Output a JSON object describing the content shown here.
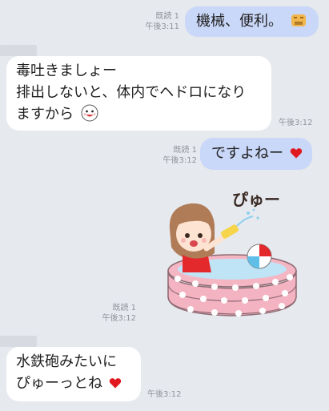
{
  "messages": [
    {
      "direction": "out",
      "text": "機械、便利。",
      "emoji": "face-with-lines-emoji",
      "read": "既読 1",
      "time": "午後3:11"
    },
    {
      "direction": "in",
      "lines": [
        "毒吐きましょー",
        "排出しないと、体内でヘドロになり",
        "ますから"
      ],
      "emoji": "grinning-face-emoji",
      "time": "午後3:12"
    },
    {
      "direction": "out",
      "text": "ですよねー",
      "emoji": "heart-emoji",
      "read": "既読 1",
      "time": "午後3:12"
    },
    {
      "direction": "out",
      "type": "sticker",
      "sticker_text": "ぴゅー",
      "read": "既読 1",
      "time": "午後3:12"
    },
    {
      "direction": "in",
      "lines": [
        "水鉄砲みたいに",
        "ぴゅーっとね"
      ],
      "emoji": "heart-emoji",
      "time": "午後3:12"
    }
  ],
  "colors": {
    "background": "#e6e9ee",
    "outgoing_bubble": "#c9d7f8",
    "incoming_bubble": "#ffffff",
    "heart": "#e0191e",
    "meta_text": "#8f939a"
  }
}
